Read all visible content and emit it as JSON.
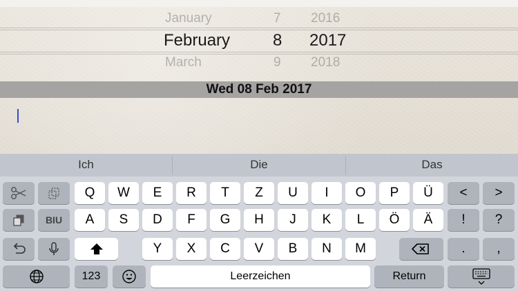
{
  "picker": {
    "prev": {
      "month": "January",
      "day": "7",
      "year": "2016"
    },
    "selected": {
      "month": "February",
      "day": "8",
      "year": "2017"
    },
    "next": {
      "month": "March",
      "day": "9",
      "year": "2018"
    }
  },
  "date_display": "Wed 08 Feb 2017",
  "keyboard": {
    "suggestions": [
      "Ich",
      "Die",
      "Das"
    ],
    "row1": [
      "Q",
      "W",
      "E",
      "R",
      "T",
      "Z",
      "U",
      "I",
      "O",
      "P",
      "Ü"
    ],
    "row2": [
      "A",
      "S",
      "D",
      "F",
      "G",
      "H",
      "J",
      "K",
      "L",
      "Ö",
      "Ä"
    ],
    "row3": [
      "Y",
      "X",
      "C",
      "V",
      "B",
      "N",
      "M"
    ],
    "left_arrow": "<",
    "right_arrow": ">",
    "exclaim": "!",
    "question": "?",
    "period": ".",
    "comma": ",",
    "numbers_label": "123",
    "space_label": "Leerzeichen",
    "return_label": "Return",
    "format_label": "BIU",
    "icons": {
      "cut": "scissors-icon",
      "copy": "copy-icon",
      "paste": "paste-icon",
      "undo": "undo-icon",
      "mic": "microphone-icon",
      "shift": "shift-icon",
      "delete": "delete-icon",
      "globe": "globe-icon",
      "emoji": "emoji-icon",
      "hide": "keyboard-dismiss-icon"
    }
  }
}
